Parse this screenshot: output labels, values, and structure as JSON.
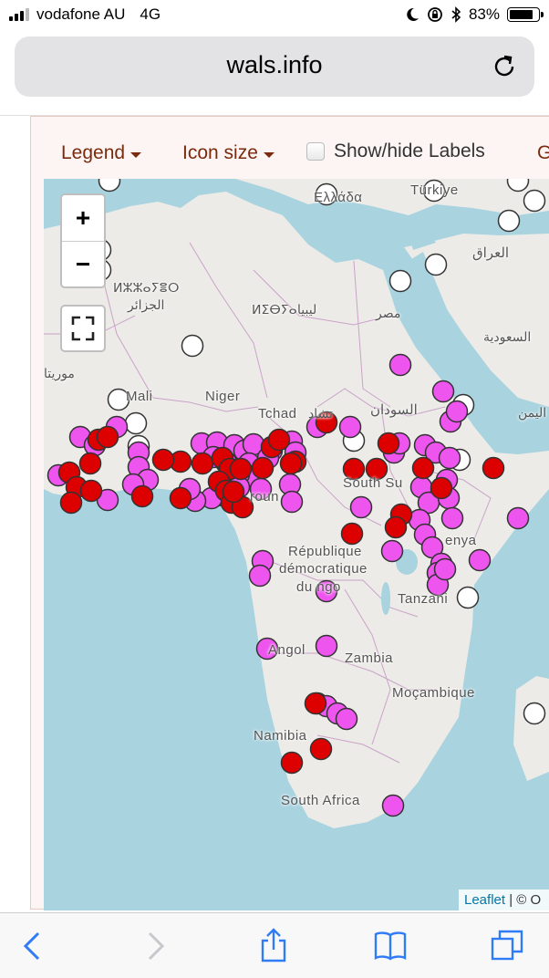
{
  "status": {
    "carrier": "vodafone AU",
    "network": "4G",
    "battery_percent": "83%",
    "battery_level": 0.83
  },
  "browser": {
    "url": "wals.info"
  },
  "toolbar": {
    "legend": "Legend",
    "icon_size": "Icon size",
    "show_hide_labels": "Show/hide Labels",
    "cut_item": "G"
  },
  "map": {
    "zoom_in": "+",
    "zoom_out": "−",
    "attribution_link": "Leaflet",
    "attribution_rest": "| © O",
    "colors": {
      "red": "#dd0000",
      "magenta": "#ee55ee",
      "white": "#ffffff",
      "water": "#a9d3df",
      "land": "#ecebe7"
    },
    "labels": {
      "ellada": "Ελλάδα",
      "turkiye": "Türkiye",
      "iraq": "العراق",
      "algeria_tif": "ⵍⵣⵣⴰⵢⴻⵔ",
      "algeria_ar": "الجزائر",
      "libya_tif": "ⵍⵉⴱⵢⴰ",
      "libya_ar": "ليبيا",
      "egypt": "مصر",
      "saudi": "السعودية",
      "mauritania": "موريتا",
      "mali": "Mali",
      "niger": "Niger",
      "tchad": "Tchad",
      "tchad_ar": "تشاد",
      "sudan": "السودان",
      "yemen": "اليمن",
      "cameroun": "roun",
      "south_sudan": "South Su",
      "kenya": "enya",
      "rdc1": "République",
      "rdc2": "démocratique",
      "rdc3": "du  ngo",
      "tanzania": "Tanzani",
      "angola": "Angol",
      "zambia": "Zambia",
      "mozambique": "Moçambique",
      "namibia": "Namibia",
      "south_africa": "South Africa"
    }
  }
}
